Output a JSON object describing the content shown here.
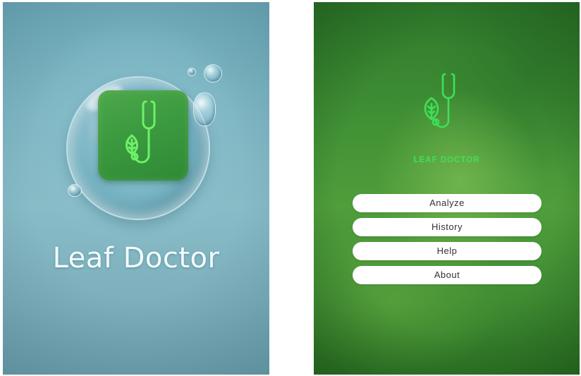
{
  "splash_screen": {
    "title": "Leaf Doctor",
    "app_icon": "leaf-stethoscope-icon",
    "background_color": "#7fb6c3",
    "tile_color": "#3b9a3f"
  },
  "menu_screen": {
    "brand": "LEAF DOCTOR",
    "logo_icon": "leaf-stethoscope-icon",
    "brand_color": "#3fe05a",
    "buttons": [
      {
        "label": "Analyze"
      },
      {
        "label": "History"
      },
      {
        "label": "Help"
      },
      {
        "label": "About"
      }
    ]
  }
}
